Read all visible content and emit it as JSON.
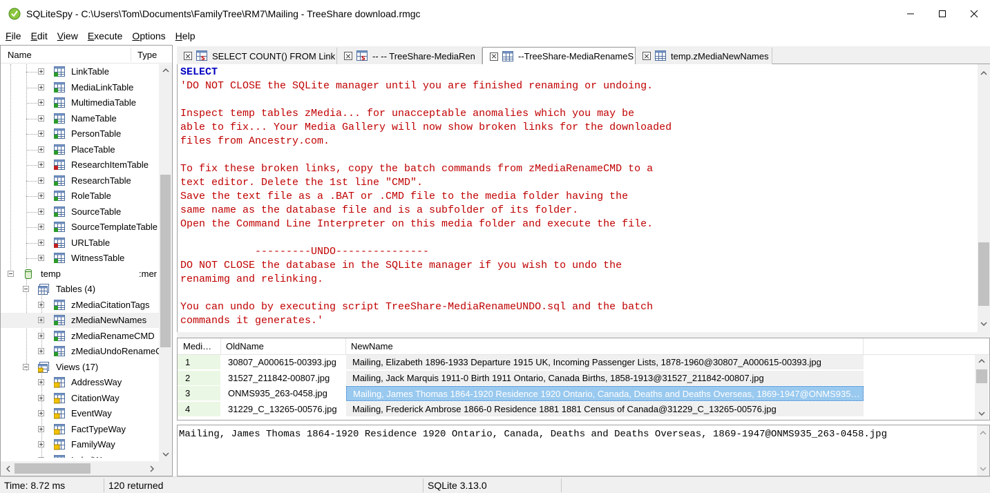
{
  "window": {
    "title": "SQLiteSpy - C:\\Users\\Tom\\Documents\\FamilyTree\\RM7\\Mailing - TreeShare download.rmgc"
  },
  "menu": [
    {
      "mn": "F",
      "rest": "ile"
    },
    {
      "mn": "E",
      "rest": "dit"
    },
    {
      "mn": "V",
      "rest": "iew"
    },
    {
      "mn": "E",
      "rest": "xecute"
    },
    {
      "mn": "O",
      "rest": "ptions"
    },
    {
      "mn": "H",
      "rest": "elp"
    }
  ],
  "tree": {
    "col_name": "Name",
    "col_type": "Type",
    "main_tables": [
      "LinkTable",
      "MediaLinkTable",
      "MultimediaTable",
      "NameTable",
      "PersonTable",
      "PlaceTable",
      "ResearchItemTable",
      "ResearchTable",
      "RoleTable",
      "SourceTable",
      "SourceTemplateTable",
      "URLTable",
      "WitnessTable"
    ],
    "temp_db": {
      "label": "temp",
      "type": ":mer"
    },
    "tables_folder": "Tables (4)",
    "temp_tables": [
      "zMediaCitationTags",
      "zMediaNewNames",
      "zMediaRenameCMD",
      "zMediaUndoRenameC"
    ],
    "views_folder": "Views (17)",
    "views": [
      "AddressWay",
      "CitationWay",
      "EventWay",
      "FactTypeWay",
      "FamilyWay",
      "LabelWay"
    ]
  },
  "tabs": [
    {
      "label": "SELECT COUNT() FROM Link",
      "icon": "sql-grid-icon",
      "active": false
    },
    {
      "label": "-- -- TreeShare-MediaRen",
      "icon": "sql-grid-icon",
      "active": false
    },
    {
      "label": "--TreeShare-MediaRenameS",
      "icon": "grid-icon",
      "active": true
    },
    {
      "label": "temp.zMediaNewNames",
      "icon": "grid-icon",
      "active": false
    }
  ],
  "sql": {
    "keyword": "SELECT",
    "lines": [
      "'DO NOT CLOSE the SQLite manager until you are finished renaming or undoing.",
      "",
      "Inspect temp tables zMedia... for unacceptable anomalies which you may be",
      "able to fix... Your Media Gallery will now show broken links for the downloaded",
      "files from Ancestry.com.",
      "",
      "To fix these broken links, copy the batch commands from zMediaRenameCMD to a",
      "text editor. Delete the 1st line \"CMD\".",
      "Save the text file as a .BAT or .CMD file to the media folder having the",
      "same name as the database file and is a subfolder of its folder.",
      "Open the Command Line Interpreter on this media folder and execute the file.",
      "",
      "            ---------UNDO---------------",
      "DO NOT CLOSE the database in the SQLite manager if you wish to undo the",
      "renamimg and relinking.",
      "",
      "You can undo by executing script TreeShare-MediaRenameUNDO.sql and the batch",
      "commands it generates.'"
    ]
  },
  "grid": {
    "columns": [
      "Medi…",
      "OldName",
      "NewName"
    ],
    "rows": [
      {
        "id": "1",
        "old": "30807_A000615-00393.jpg",
        "new": "Mailing, Elizabeth 1896-1933 Departure 1915 UK, Incoming Passenger Lists, 1878-1960@30807_A000615-00393.jpg"
      },
      {
        "id": "2",
        "old": "31527_211842-00807.jpg",
        "new": "Mailing, Jack Marquis 1911-0 Birth 1911 Ontario, Canada Births, 1858-1913@31527_211842-00807.jpg"
      },
      {
        "id": "3",
        "old": "ONMS935_263-0458.jpg",
        "new": "Mailing, James Thomas 1864-1920 Residence 1920 Ontario, Canada, Deaths and Deaths Overseas, 1869-1947@ONMS935_263-0458.jpg"
      },
      {
        "id": "4",
        "old": "31229_C_13265-00576.jpg",
        "new": "Mailing, Frederick Ambrose 1866-0 Residence 1881 1881 Census of Canada@31229_C_13265-00576.jpg"
      }
    ],
    "selected_row": 2
  },
  "detail": {
    "text": "Mailing, James Thomas 1864-1920 Residence 1920 Ontario, Canada, Deaths and Deaths Overseas, 1869-1947@ONMS935_263-0458.jpg"
  },
  "status": {
    "time": "Time: 8.72 ms",
    "returned": "120 returned",
    "version": "SQLite 3.13.0"
  }
}
